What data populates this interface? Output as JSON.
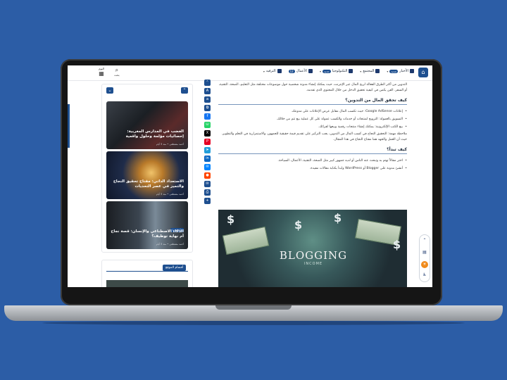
{
  "header": {
    "nav": [
      {
        "label": "الأخبار",
        "badge": "جديد"
      },
      {
        "label": "المجتمع",
        "badge": ""
      },
      {
        "label": "التكنولوجيا",
        "badge": "جديد"
      },
      {
        "label": "الأعمال",
        "badge": "12"
      },
      {
        "label": "الترفيه",
        "badge": ""
      }
    ],
    "search_label": "بحث",
    "date_label": "اليوم"
  },
  "sidebar": {
    "posts": [
      {
        "title": "الغضب في المدارس المغربية: إحصائيات مؤلمة وحلول واقعية",
        "meta": "أحمد مصطفى  •  منذ 3 أيام"
      },
      {
        "title": "الاستعداد الذاتي: مفتاح تحقيق النجاح والتميز في عصر التحديات",
        "meta": "أحمد مصطفى  •  منذ 3 أيام"
      },
      {
        "title": "الذكاء الاصطناعي والإنسان: قصة نجاح أم نهاية توظيف؟",
        "tag": "تكنولوجيا",
        "meta": "أحمد مصطفى  •  منذ 3 أيام"
      }
    ],
    "widget2_title": "أقسام الموقع"
  },
  "article": {
    "intro": "التدوين من أكثر الطرق الفعالة لربح المال عبر الإنترنت، حيث يمكنك إنشاء مدونة شخصية حول موضوعات مختلفة مثل التعليم، الصحة، التقنية، أو السفر. الفن يكمن في كيفية تحقيق الدخل من خلال المحتوى الذي تقدمه.",
    "h_money": "كيف تحقق المال من التدوين؟",
    "bullets1": [
      "إعلانات Google AdSense: حيث تكسب المال مقابل عرض الإعلانات على مدونتك.",
      "التسويق بالعمولة: الترويج لمنتجات أو خدمات والكسب عمولة على كل عملية بيع تتم من خلالك.",
      "بيع الكتب الإلكترونية: يمكنك إنشاء منتجات رقمية وبيعها لقرائك."
    ],
    "note": "ملاحظة مهمة: التحقيق النجاح في كسب المال من التدوين، يجب التركيز على تقديم قيمة حقيقية للجمهور، والاستمرارية في التعلم والتطوير. حيث أن العمل والجهد هما مفتاح النجاح في هذا المجال.",
    "h_start": "كيف تبدأ؟",
    "bullets2": [
      "اختر مجالاً تهتم به وتبحث عنه الناس أو لديه جمهور كبير مثل الصحة، التقنية، الأعمال، السياحة.",
      "أنشئ مدونة على Blogger أو WordPress وابدأ بكتابة مقالات مفيدة."
    ],
    "hero_title": "BLOGGING",
    "hero_sub": "INCOME"
  },
  "colors": {
    "accent": "#1e4f8f",
    "background": "#2c5da6"
  }
}
